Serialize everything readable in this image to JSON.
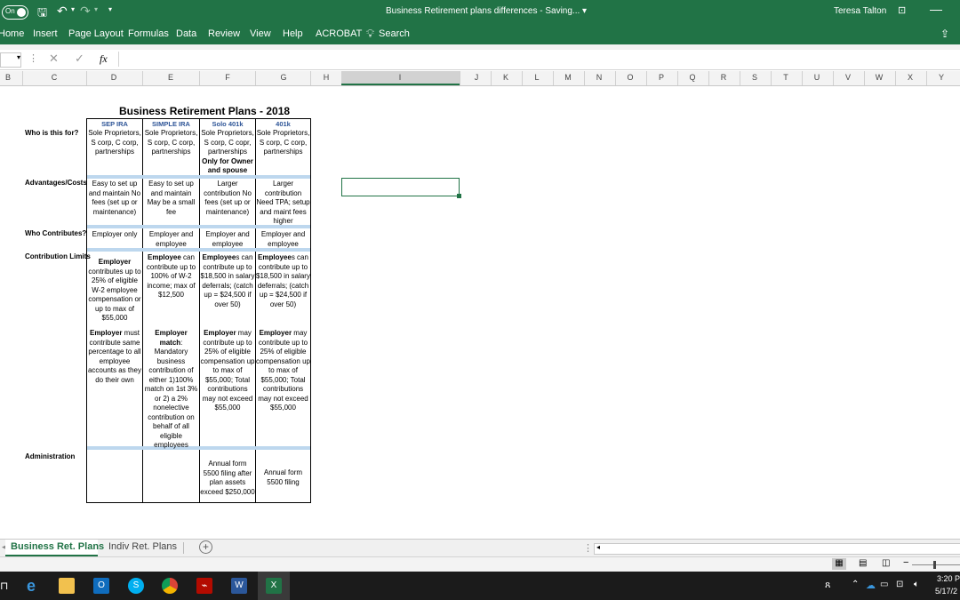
{
  "titlebar": {
    "autosave": "On",
    "title": "Business Retirement plans differences  -  Saving...  ▾",
    "user": "Teresa Talton"
  },
  "ribbon": {
    "tabs": [
      "Home",
      "Insert",
      "Page Layout",
      "Formulas",
      "Data",
      "Review",
      "View",
      "Help",
      "ACROBAT"
    ],
    "search": "Search"
  },
  "formula_bar": {
    "fx": "fx"
  },
  "columns": [
    "B",
    "C",
    "D",
    "E",
    "F",
    "G",
    "H",
    "I",
    "J",
    "K",
    "L",
    "M",
    "N",
    "O",
    "P",
    "Q",
    "R",
    "S",
    "T",
    "U",
    "V",
    "W",
    "X",
    "Y"
  ],
  "sheet": {
    "title": "Business Retirement Plans - 2018",
    "row_labels": {
      "who": "Who is this for?",
      "adv": "Advantages/Costs",
      "contrib": "Who Contributes?",
      "limits": "Contribution Limits",
      "admin": "Administration"
    },
    "headers": [
      "SEP IRA",
      "SIMPLE IRA",
      "Solo 401k",
      "401k"
    ],
    "who": {
      "sep": "Sole Proprietors, S corp, C corp, partnerships",
      "simple": "Sole Proprietors, S corp, C corp, partnerships",
      "solo": "Sole Proprietors, S corp, C copr, partnerships",
      "solo_bold": "Only for Owner and spouse",
      "k401": "Sole Proprietors, S corp, C corp, partnerships"
    },
    "adv": {
      "sep": "Easy to set up and maintain No fees (set up or maintenance)",
      "simple": "Easy to set up and maintain May be a small fee",
      "solo": "Larger contribution No fees (set up or maintenance)",
      "k401": "Larger contribution Need TPA; setup and maint fees higher"
    },
    "contributes": {
      "sep": "Employer only",
      "simple": "Employer and employee",
      "solo": "Employer and employee",
      "k401": "Employer and employee"
    },
    "limits1": {
      "sep_bold": "Employer",
      "sep": "contributes up to 25% of eligible W-2 employee compensation or up to max of $55,000",
      "simple_bold": "Employee",
      "simple": " can contribute up to 100% of W-2 income; max of $12,500",
      "solo_bold": "Employee",
      "solo": "s can contribute up to $18,500 in salary deferrals; (catch up = $24,500 if over 50)",
      "k401_bold": "Employee",
      "k401": "s can contribute up to $18,500 in salary deferrals; (catch up = $24,500 if over 50)"
    },
    "limits2": {
      "sep_bold": "Employer",
      "sep": " must contribute same percentage to all employee accounts as they do their own",
      "simple_bold": "Employer match",
      "simple": ": Mandatory business contribution of either 1)100% match on 1st 3% or 2) a 2% nonelective contribution on behalf of all eligible employees",
      "solo_bold": "Employer",
      "solo": " may contribute up to 25% of eligible compensation up to max of $55,000; Total contributions may not exceed $55,000",
      "k401_bold": "Employer",
      "k401": " may contribute up to 25% of eligible compensation up to max of $55,000; Total contributions may not exceed $55,000"
    },
    "admin": {
      "solo": "Annual form 5500 filing after plan assets exceed $250,000",
      "k401": "Annual form 5500 filing"
    }
  },
  "sheet_tabs": [
    "Business Ret. Plans",
    "Indiv Ret. Plans"
  ],
  "clock": {
    "time": "3:20 P",
    "date": "5/17/2"
  }
}
